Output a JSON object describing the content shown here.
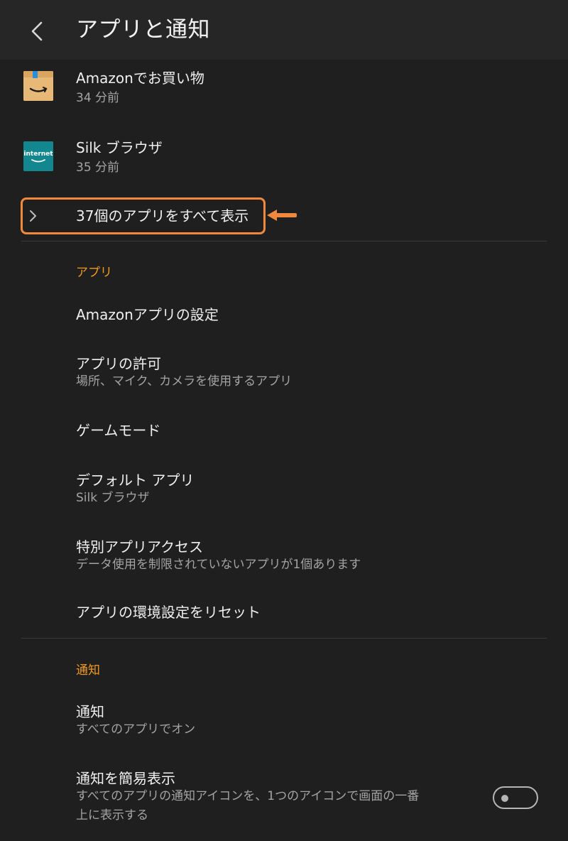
{
  "header": {
    "title": "アプリと通知",
    "back_icon": "back-chevron-icon"
  },
  "recent_apps": [
    {
      "name": "Amazonでお買い物",
      "time": "34 分前",
      "icon": "amazon-shopping-icon",
      "icon_color": "#e8b877"
    },
    {
      "name": "Silk ブラウザ",
      "time": "35 分前",
      "icon": "silk-internet-icon",
      "icon_text": "internet",
      "icon_color": "#12878f"
    }
  ],
  "see_all": {
    "label": "37個のアプリをすべて表示",
    "icon": "chevron-right-icon"
  },
  "apps_section": {
    "header": "アプリ",
    "items": [
      {
        "title": "Amazonアプリの設定"
      },
      {
        "title": "アプリの許可",
        "subtitle": "場所、マイク、カメラを使用するアプリ"
      },
      {
        "title": "ゲームモード"
      },
      {
        "title": "デフォルト アプリ",
        "subtitle": "Silk ブラウザ"
      },
      {
        "title": "特別アプリアクセス",
        "subtitle": "データ使用を制限されていないアプリが1個あります"
      },
      {
        "title": "アプリの環境設定をリセット"
      }
    ]
  },
  "notif_section": {
    "header": "通知",
    "items": [
      {
        "title": "通知",
        "subtitle": "すべてのアプリでオン"
      },
      {
        "title": "通知を簡易表示",
        "subtitle_line1": "すべてのアプリの通知アイコンを、1つのアイコンで画面の一番",
        "subtitle_line2": "上に表示する",
        "toggle_on": false
      }
    ]
  },
  "colors": {
    "background": "#1f1f1f",
    "header": "#262626",
    "accent": "#f29a1c",
    "annotation": "#f0883e"
  }
}
